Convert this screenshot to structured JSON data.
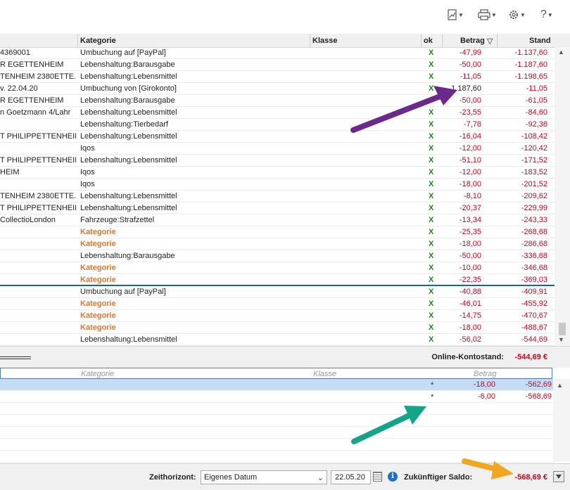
{
  "toolbar": {
    "chart_icon": "chart-icon",
    "print_icon": "print-icon",
    "settings_icon": "gear-icon",
    "help_label": "?"
  },
  "columns": {
    "kategorie": "Kategorie",
    "klasse": "Klasse",
    "ok": "ok",
    "betrag": "Betrag",
    "sort_indicator": "▽",
    "stand": "Stand"
  },
  "rows": [
    {
      "text": "4369001",
      "kategorie": "Umbuchung auf [PayPal]",
      "orange": false,
      "ok": "X",
      "betrag": "-47,99",
      "stand": "-1.137,60"
    },
    {
      "text": "R EGETTENHEIM",
      "kategorie": "Lebenshaltung:Barausgabe",
      "orange": false,
      "ok": "X",
      "betrag": "-50,00",
      "stand": "-1.187,60"
    },
    {
      "text": "TENHEIM 2380ETTE...",
      "kategorie": "Lebenshaltung:Lebensmittel",
      "orange": false,
      "ok": "X",
      "betrag": "-11,05",
      "stand": "-1.198,65"
    },
    {
      "text": "v. 22.04.20",
      "kategorie": "Umbuchung von [Girokonto]",
      "orange": false,
      "ok": "X",
      "betrag": "1.187,60",
      "pos": true,
      "stand": "-11,05"
    },
    {
      "text": "R EGETTENHEIM",
      "kategorie": "Lebenshaltung:Barausgabe",
      "orange": false,
      "ok": "",
      "betrag": "-50,00",
      "stand": "-61,05"
    },
    {
      "text": "n Goetzmann 4/Lahr",
      "kategorie": "Lebenshaltung:Lebensmittel",
      "orange": false,
      "ok": "X",
      "betrag": "-23,55",
      "stand": "-84,60"
    },
    {
      "text": "",
      "kategorie": "Lebenshaltung:Tierbedarf",
      "orange": false,
      "ok": "X",
      "betrag": "-7,78",
      "stand": "-92,38"
    },
    {
      "text": "T PHILIPPETTENHEIM",
      "kategorie": "Lebenshaltung:Lebensmittel",
      "orange": false,
      "ok": "X",
      "betrag": "-16,04",
      "stand": "-108,42"
    },
    {
      "text": "",
      "kategorie": "Iqos",
      "orange": false,
      "ok": "X",
      "betrag": "-12,00",
      "stand": "-120,42"
    },
    {
      "text": "T PHILIPPETTENHEIM",
      "kategorie": "Lebenshaltung:Lebensmittel",
      "orange": false,
      "ok": "X",
      "betrag": "-51,10",
      "stand": "-171,52"
    },
    {
      "text": "HEIM",
      "kategorie": "Iqos",
      "orange": false,
      "ok": "X",
      "betrag": "-12,00",
      "stand": "-183,52"
    },
    {
      "text": "",
      "kategorie": "Iqos",
      "orange": false,
      "ok": "X",
      "betrag": "-18,00",
      "stand": "-201,52"
    },
    {
      "text": "TENHEIM 2380ETTE...",
      "kategorie": "Lebenshaltung:Lebensmittel",
      "orange": false,
      "ok": "X",
      "betrag": "-8,10",
      "stand": "-209,62"
    },
    {
      "text": "T PHILIPPETTENHEIM",
      "kategorie": "Lebenshaltung:Lebensmittel",
      "orange": false,
      "ok": "X",
      "betrag": "-20,37",
      "stand": "-229,99"
    },
    {
      "text": "CollectioLondon",
      "kategorie": "Fahrzeuge:Strafzettel",
      "orange": false,
      "ok": "X",
      "betrag": "-13,34",
      "stand": "-243,33"
    },
    {
      "text": "",
      "kategorie": "Kategorie",
      "orange": true,
      "ok": "X",
      "betrag": "-25,35",
      "stand": "-268,68"
    },
    {
      "text": "",
      "kategorie": "Kategorie",
      "orange": true,
      "ok": "X",
      "betrag": "-18,00",
      "stand": "-286,68"
    },
    {
      "text": "",
      "kategorie": "Lebenshaltung:Barausgabe",
      "orange": false,
      "ok": "X",
      "betrag": "-50,00",
      "stand": "-336,68"
    },
    {
      "text": "",
      "kategorie": "Kategorie",
      "orange": true,
      "ok": "X",
      "betrag": "-10,00",
      "stand": "-346,68"
    },
    {
      "text": "",
      "kategorie": "Kategorie",
      "orange": true,
      "ok": "X",
      "betrag": "-22,35",
      "stand": "-369,03",
      "sep": true
    },
    {
      "text": "",
      "kategorie": "Umbuchung auf [PayPal]",
      "orange": false,
      "ok": "X",
      "betrag": "-40,88",
      "stand": "-409,91"
    },
    {
      "text": "",
      "kategorie": "Kategorie",
      "orange": true,
      "ok": "X",
      "betrag": "-46,01",
      "stand": "-455,92"
    },
    {
      "text": "",
      "kategorie": "Kategorie",
      "orange": true,
      "ok": "X",
      "betrag": "-14,75",
      "stand": "-470,67"
    },
    {
      "text": "",
      "kategorie": "Kategorie",
      "orange": true,
      "ok": "X",
      "betrag": "-18,00",
      "stand": "-488,67"
    },
    {
      "text": "",
      "kategorie": "Lebenshaltung:Lebensmittel",
      "orange": false,
      "ok": "X",
      "betrag": "-56,02",
      "stand": "-544,69"
    }
  ],
  "online": {
    "label": "Online-Kontostand:",
    "value": "-544,69 €"
  },
  "future_header": {
    "kategorie": "Kategorie",
    "klasse": "Klasse",
    "betrag": "Betrag"
  },
  "future_rows": [
    {
      "star": "*",
      "betrag": "-18,00",
      "stand": "-562,69",
      "selected": true
    },
    {
      "star": "*",
      "betrag": "-6,00",
      "stand": "-568,69",
      "selected": false
    }
  ],
  "bottom": {
    "zeithorizont_label": "Zeithorizont:",
    "horizon_value": "Eigenes Datum",
    "date_value": "22.05.20",
    "info_label": "i",
    "saldo_label": "Zukünftiger Saldo:",
    "saldo_value": "-568,69 €"
  },
  "colors": {
    "negative": "#d0021b",
    "ok_green": "#1a8a1a",
    "uncategorized": "#e8742a",
    "arrow_purple": "#6a2a8c",
    "arrow_teal": "#14a589",
    "arrow_orange": "#f2a81e"
  }
}
